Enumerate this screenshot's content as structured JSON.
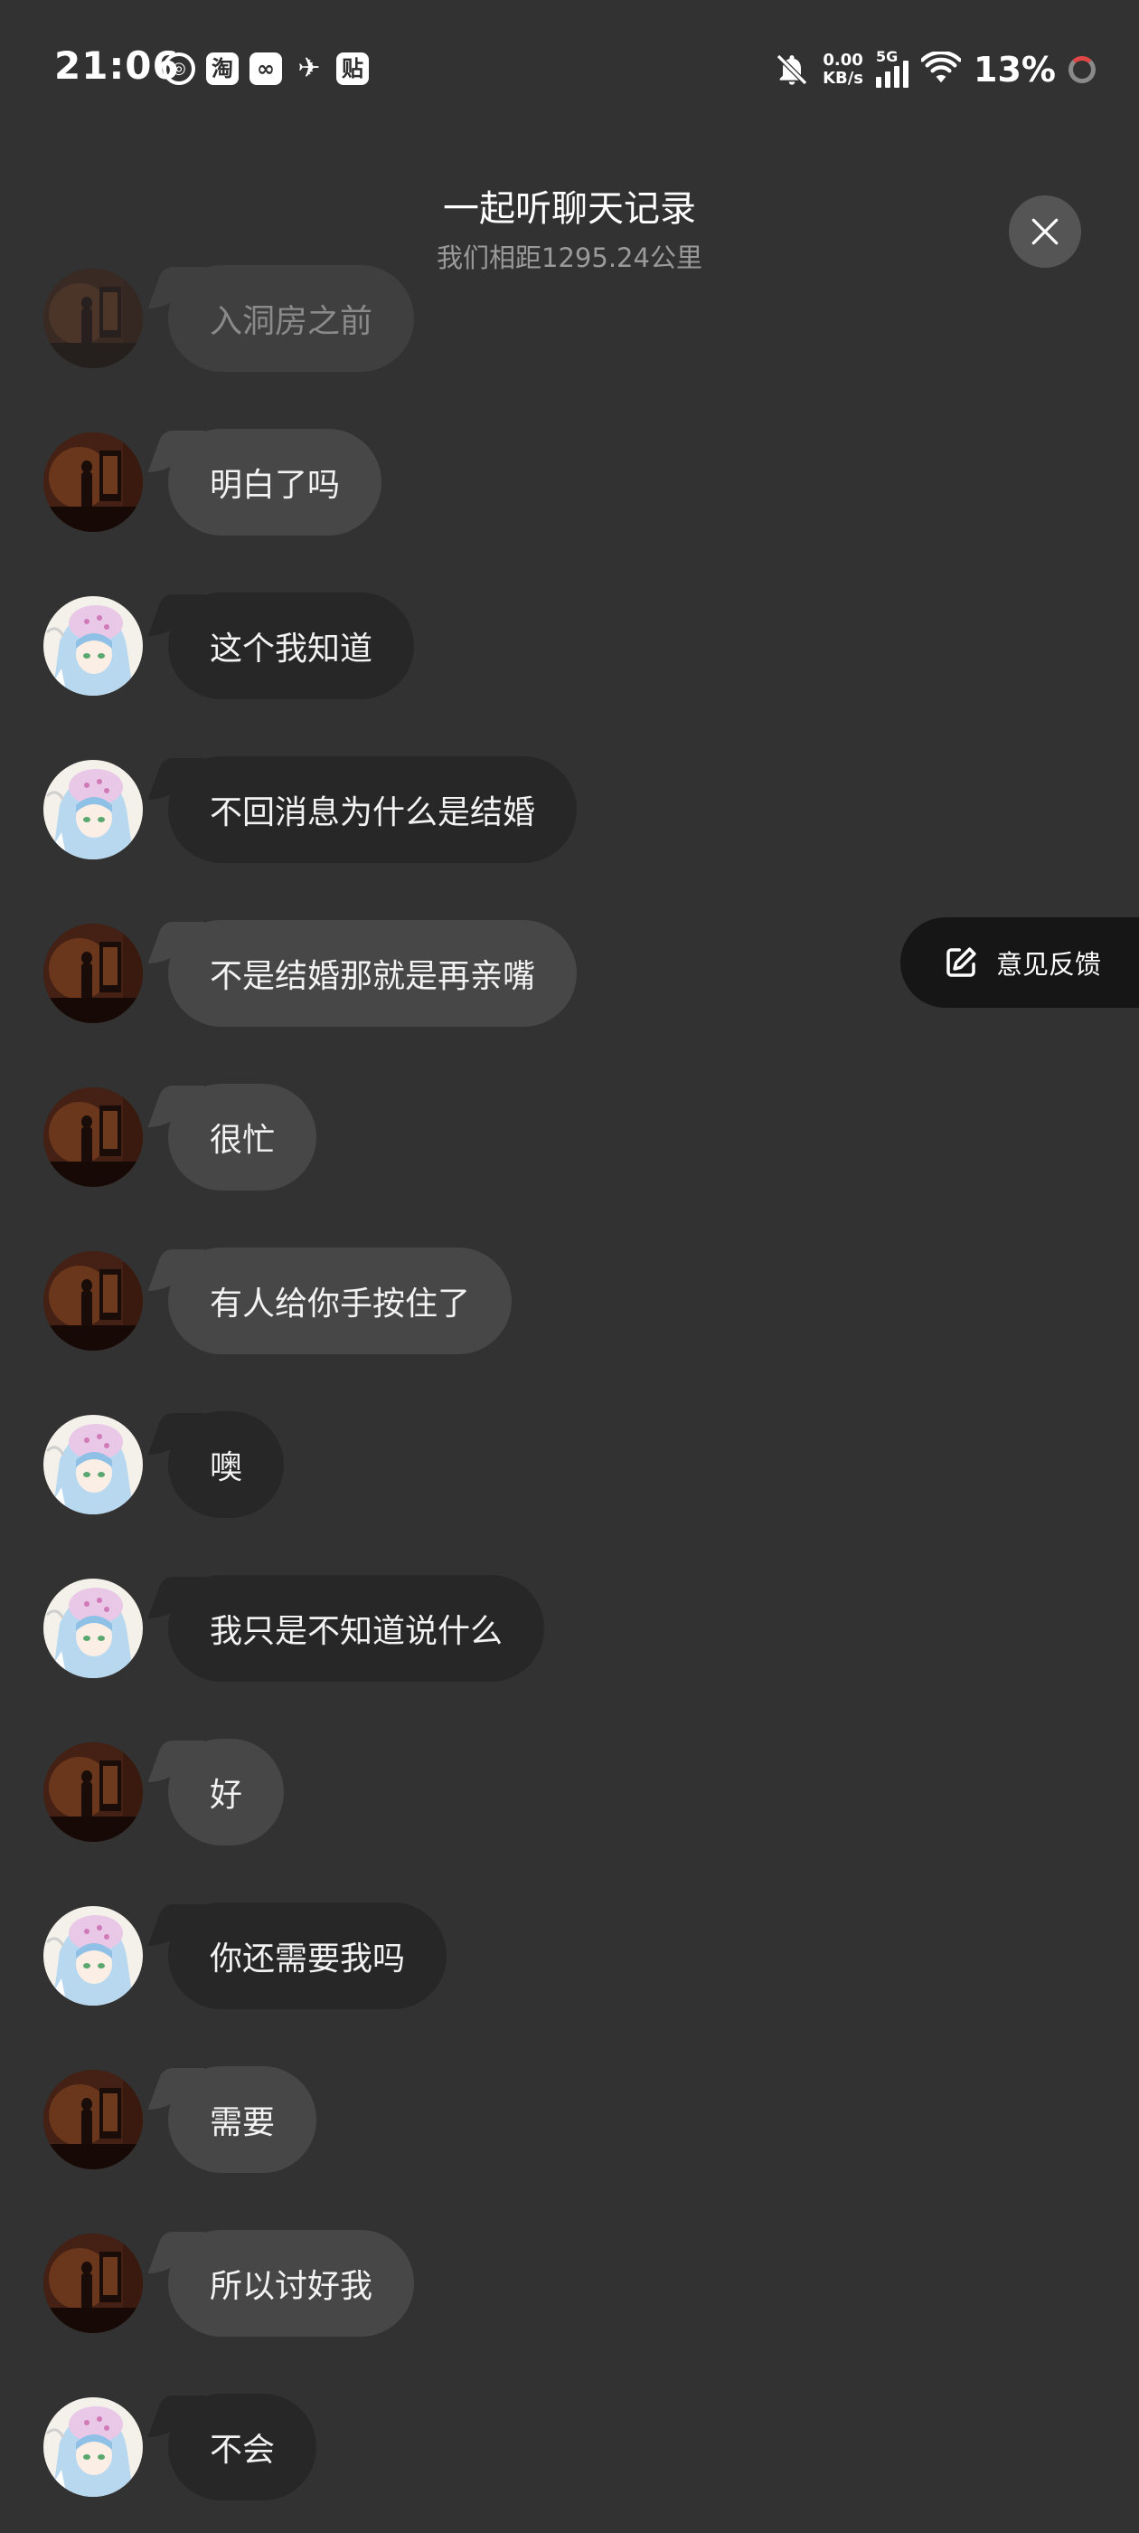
{
  "status_bar": {
    "time": "21:06",
    "app_icons": [
      "weibo-icon",
      "taobao-icon",
      "xianyu-icon",
      "bird-icon",
      "tieba-icon"
    ],
    "app_icon_glyphs": [
      "◎",
      "淘",
      "∞",
      "✈",
      "贴"
    ],
    "net_speed_value": "0.00",
    "net_speed_unit": "KB/s",
    "network_type": "5G",
    "battery": "13%"
  },
  "header": {
    "title": "一起听聊天记录",
    "subtitle": "我们相距1295.24公里"
  },
  "feedback": {
    "label": "意见反馈"
  },
  "avatar_types": {
    "a": "dark-room-figure-avatar",
    "b": "anime-blue-hair-avatar"
  },
  "colors": {
    "background": "#323232",
    "bubble_light": "#474747",
    "bubble_dark": "#272727",
    "feedback_bg": "#161616"
  },
  "messages": [
    {
      "text": "入洞房之前",
      "avatar": "a"
    },
    {
      "text": "明白了吗",
      "avatar": "a"
    },
    {
      "text": "这个我知道",
      "avatar": "b"
    },
    {
      "text": "不回消息为什么是结婚",
      "avatar": "b"
    },
    {
      "text": "不是结婚那就是再亲嘴",
      "avatar": "a"
    },
    {
      "text": "很忙",
      "avatar": "a"
    },
    {
      "text": "有人给你手按住了",
      "avatar": "a"
    },
    {
      "text": "噢",
      "avatar": "b"
    },
    {
      "text": "我只是不知道说什么",
      "avatar": "b"
    },
    {
      "text": "好",
      "avatar": "a"
    },
    {
      "text": "你还需要我吗",
      "avatar": "b"
    },
    {
      "text": "需要",
      "avatar": "a"
    },
    {
      "text": "所以讨好我",
      "avatar": "a"
    },
    {
      "text": "不会",
      "avatar": "b"
    }
  ]
}
